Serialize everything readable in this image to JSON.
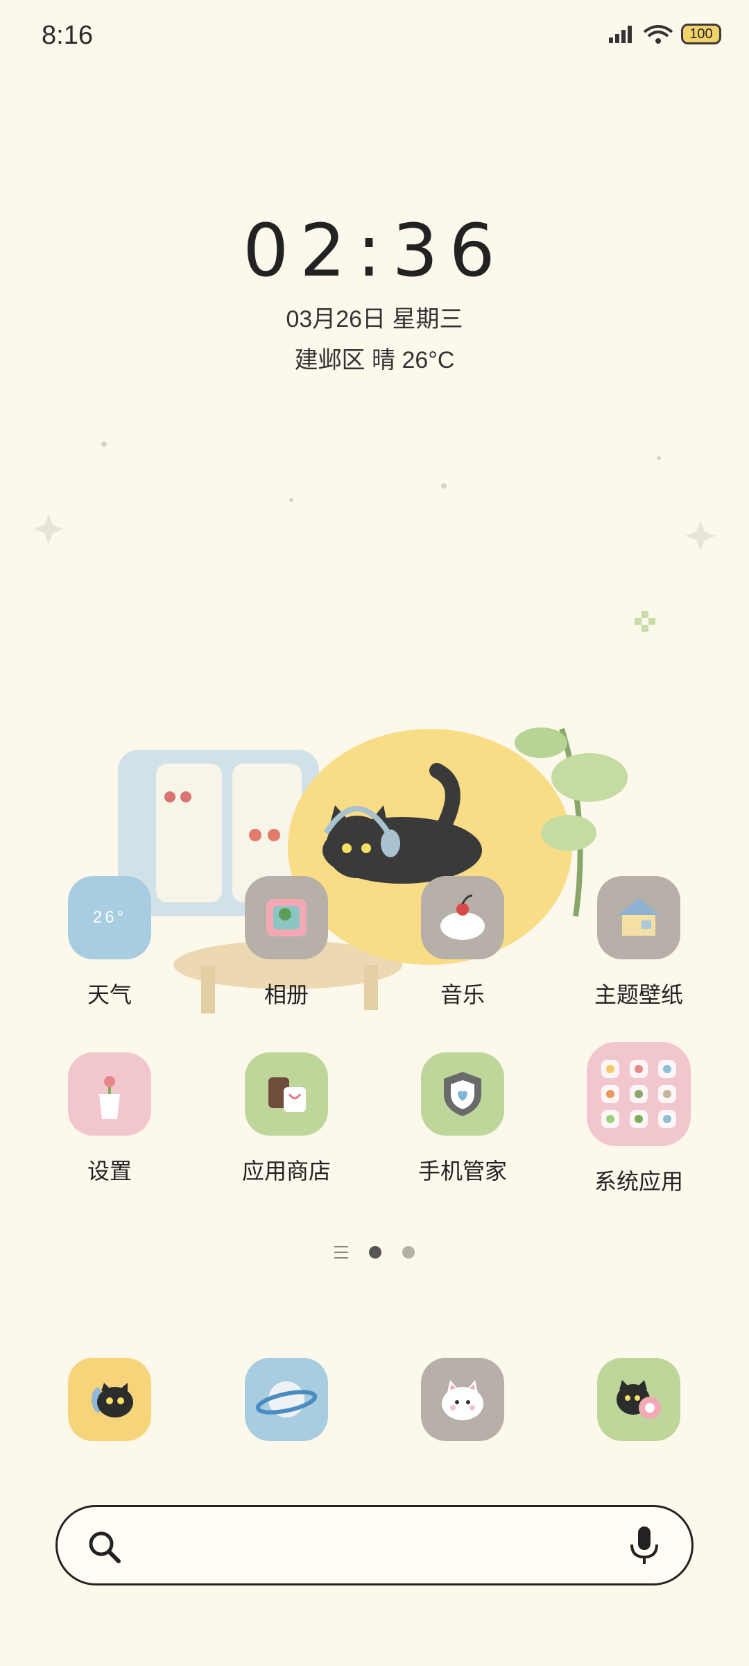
{
  "status_bar": {
    "time": "8:16",
    "battery": "100"
  },
  "clock_widget": {
    "time": "02:36",
    "date": "03月26日 星期三",
    "weather": "建邺区 晴 26°C"
  },
  "apps_row1": [
    {
      "label": "天气",
      "icon": "weather-icon",
      "icon_text": "26°"
    },
    {
      "label": "相册",
      "icon": "gallery-icon"
    },
    {
      "label": "音乐",
      "icon": "music-icon"
    },
    {
      "label": "主题壁纸",
      "icon": "themes-icon"
    }
  ],
  "apps_row2": [
    {
      "label": "设置",
      "icon": "settings-icon"
    },
    {
      "label": "应用商店",
      "icon": "app-store-icon"
    },
    {
      "label": "手机管家",
      "icon": "phone-manager-icon"
    },
    {
      "label": "系统应用",
      "icon": "system-apps-folder-icon"
    }
  ],
  "dock": [
    {
      "icon": "phone-icon"
    },
    {
      "icon": "browser-icon"
    },
    {
      "icon": "messages-icon"
    },
    {
      "icon": "camera-icon"
    }
  ],
  "page_indicator": {
    "pages": 2,
    "active": 1
  },
  "colors": {
    "background": "#fdf8ec",
    "blue": "#a8cde0",
    "gray": "#b6b0a8",
    "pink": "#f2c6cd",
    "green": "#bfd69a",
    "yellow": "#f6d57a"
  }
}
